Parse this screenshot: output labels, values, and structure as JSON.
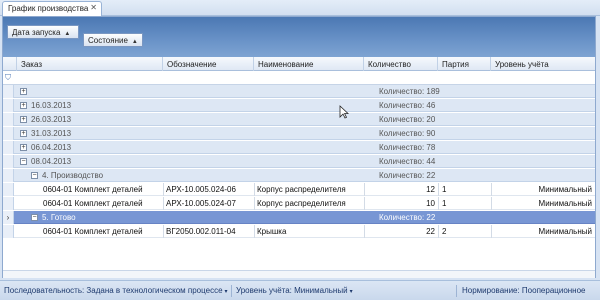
{
  "tab": {
    "title": "График производства",
    "close": "✕"
  },
  "group_panel": {
    "chips": [
      {
        "label": "Дата запуска",
        "sort": "▲"
      },
      {
        "label": "Состояние",
        "sort": "▲"
      }
    ]
  },
  "columns": [
    "Заказ",
    "Обозначение",
    "Наименование",
    "Количество",
    "Партия",
    "Уровень учёта"
  ],
  "filter_icon": "⛉",
  "groups_top": [
    {
      "label": "",
      "count": "Количество: 189"
    },
    {
      "label": "16.03.2013",
      "count": "Количество: 46"
    },
    {
      "label": "26.03.2013",
      "count": "Количество: 20"
    },
    {
      "label": "31.03.2013",
      "count": "Количество: 90"
    },
    {
      "label": "06.04.2013",
      "count": "Количество: 78"
    },
    {
      "label": "08.04.2013",
      "count": "Количество: 44"
    }
  ],
  "subgroup_1": {
    "label": "4. Производство",
    "count": "Количество: 22"
  },
  "rows_1": [
    {
      "order": "0604-01 Комплект деталей",
      "designation": "АРХ-10.005.024-06",
      "name": "Корпус распределителя",
      "qty": "12",
      "batch": "1",
      "level": "Минимальный"
    },
    {
      "order": "0604-01 Комплект деталей",
      "designation": "АРХ-10.005.024-07",
      "name": "Корпус распределителя",
      "qty": "10",
      "batch": "1",
      "level": "Минимальный"
    }
  ],
  "subgroup_2": {
    "label": "5. Готово",
    "count": "Количество: 22",
    "indicator": "›"
  },
  "rows_2": [
    {
      "order": "0604-01 Комплект деталей",
      "designation": "ВГ2050.002.011-04",
      "name": "Крышка",
      "qty": "22",
      "batch": "2",
      "level": "Минимальный"
    }
  ],
  "status": {
    "sequence": "Последовательность: Задана в технологическом процессе",
    "level": "Уровень учёта: Минимальный",
    "norm": "Нормирование: Пооперационное",
    "caret": "▾"
  },
  "expand_plus": "+",
  "expand_minus": "−"
}
